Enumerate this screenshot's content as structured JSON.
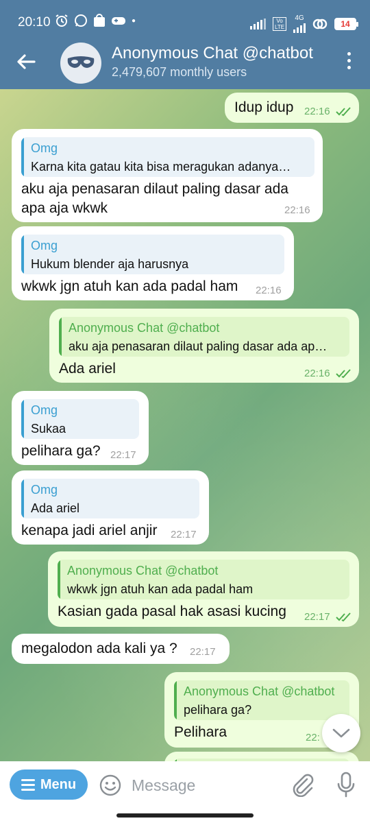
{
  "status_bar": {
    "time": "20:10",
    "network": "4G",
    "volte": "Vo LTE",
    "battery": "14"
  },
  "header": {
    "title": "Anonymous Chat @chatbot",
    "subtitle": "2,479,607 monthly users"
  },
  "messages": [
    {
      "text": "Idup idup",
      "time": "22:16"
    },
    {
      "quote_name": "Omg",
      "quote_text": "Karna kita gatau kita bisa meragukan adanya…",
      "line1": "aku aja penasaran dilaut paling dasar ada",
      "line2": "apa aja wkwk",
      "time": "22:16"
    },
    {
      "quote_name": "Omg",
      "quote_text": "Hukum blender aja harusnya",
      "text": "wkwk jgn atuh kan ada padal ham",
      "time": "22:16"
    },
    {
      "quote_name": "Anonymous Chat @chatbot",
      "quote_text": "aku aja penasaran dilaut paling dasar ada ap…",
      "text": "Ada ariel",
      "time": "22:16"
    },
    {
      "quote_name": "Omg",
      "quote_text": "Sukaa",
      "text": "pelihara ga?",
      "time": "22:17"
    },
    {
      "quote_name": "Omg",
      "quote_text": "Ada ariel",
      "text": "kenapa jadi ariel anjir",
      "time": "22:17"
    },
    {
      "quote_name": "Anonymous Chat @chatbot",
      "quote_text": "wkwk jgn atuh kan ada padal ham",
      "text": "Kasian gada pasal hak asasi kucing",
      "time": "22:17"
    },
    {
      "text": "megalodon ada kali ya ?",
      "time": "22:17"
    },
    {
      "quote_name": "Anonymous Chat @chatbot",
      "quote_text": "pelihara ga?",
      "text": "Pelihara",
      "time": "22:"
    }
  ],
  "input": {
    "menu_label": "Menu",
    "placeholder": "Message"
  },
  "colors": {
    "header": "#517da2",
    "incoming_bubble": "#ffffff",
    "outgoing_bubble": "#effedd",
    "menu_button": "#4ea4e0",
    "incoming_quote_accent": "#3a9fd1",
    "outgoing_quote_accent": "#4fae4e"
  }
}
